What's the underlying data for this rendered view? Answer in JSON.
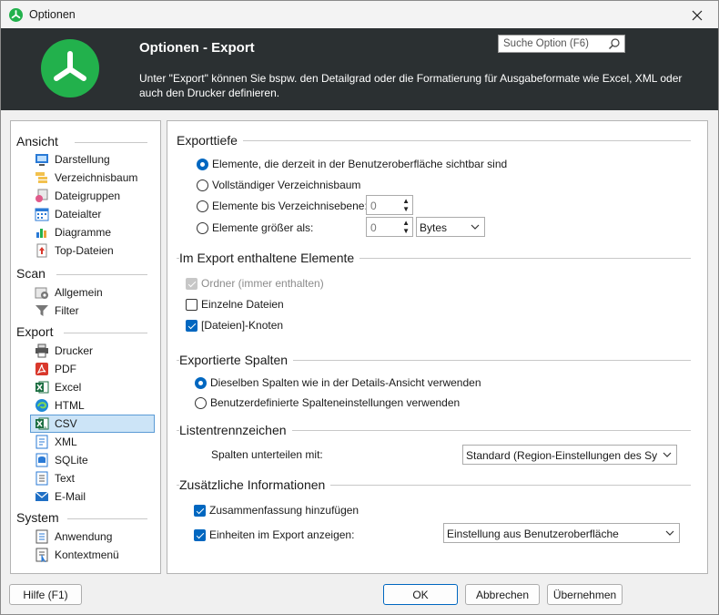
{
  "window": {
    "title": "Optionen"
  },
  "header": {
    "title": "Optionen - Export",
    "description": "Unter \"Export\" können Sie bspw. den Detailgrad oder die Formatierung für Ausgabeformate wie Excel, XML oder auch den Drucker definieren.",
    "search_placeholder": "Suche Option (F6)"
  },
  "nav": {
    "sections": [
      {
        "label": "Ansicht",
        "items": [
          {
            "label": "Darstellung",
            "icon": "display-icon"
          },
          {
            "label": "Verzeichnisbaum",
            "icon": "tree-icon"
          },
          {
            "label": "Dateigruppen",
            "icon": "filegroups-icon"
          },
          {
            "label": "Dateialter",
            "icon": "calendar-icon"
          },
          {
            "label": "Diagramme",
            "icon": "chart-icon"
          },
          {
            "label": "Top-Dateien",
            "icon": "top-files-icon"
          }
        ]
      },
      {
        "label": "Scan",
        "items": [
          {
            "label": "Allgemein",
            "icon": "settings-icon"
          },
          {
            "label": "Filter",
            "icon": "filter-icon"
          }
        ]
      },
      {
        "label": "Export",
        "items": [
          {
            "label": "Drucker",
            "icon": "printer-icon"
          },
          {
            "label": "PDF",
            "icon": "pdf-icon"
          },
          {
            "label": "Excel",
            "icon": "excel-icon"
          },
          {
            "label": "HTML",
            "icon": "html-icon"
          },
          {
            "label": "CSV",
            "icon": "csv-icon",
            "selected": true
          },
          {
            "label": "XML",
            "icon": "xml-icon"
          },
          {
            "label": "SQLite",
            "icon": "sqlite-icon"
          },
          {
            "label": "Text",
            "icon": "text-icon"
          },
          {
            "label": "E-Mail",
            "icon": "email-icon"
          }
        ]
      },
      {
        "label": "System",
        "items": [
          {
            "label": "Anwendung",
            "icon": "application-icon"
          },
          {
            "label": "Kontextmenü",
            "icon": "context-menu-icon"
          }
        ]
      }
    ]
  },
  "exporttiefe": {
    "title": "Exporttiefe",
    "opt_visible": "Elemente, die derzeit in der Benutzeroberfläche sichtbar sind",
    "opt_full": "Vollständiger Verzeichnisbaum",
    "opt_level": "Elemente bis Verzeichnisebene:",
    "opt_level_value": "0",
    "opt_size": "Elemente größer als:",
    "opt_size_value": "0",
    "opt_size_unit": "Bytes"
  },
  "elemente": {
    "title": "Im Export enthaltene Elemente",
    "folders": "Ordner (immer enthalten)",
    "files": "Einzelne Dateien",
    "files_node": "[Dateien]-Knoten"
  },
  "spalten": {
    "title": "Exportierte Spalten",
    "same": "Dieselben Spalten wie in der Details-Ansicht verwenden",
    "custom": "Benutzerdefinierte Spalteneinstellungen verwenden"
  },
  "listentrenn": {
    "title": "Listentrennzeichen",
    "label": "Spalten unterteilen mit:",
    "value": "Standard (Region-Einstellungen des Syst"
  },
  "zusatz": {
    "title": "Zusätzliche Informationen",
    "summary": "Zusammenfassung hinzufügen",
    "units": "Einheiten im Export anzeigen:",
    "units_value": "Einstellung aus Benutzeroberfläche"
  },
  "buttons": {
    "help": "Hilfe (F1)",
    "ok": "OK",
    "cancel": "Abbrechen",
    "apply": "Übernehmen"
  },
  "colors": {
    "accent": "#0067c0",
    "brand": "#22b14c",
    "header_bg": "#2b3032"
  }
}
